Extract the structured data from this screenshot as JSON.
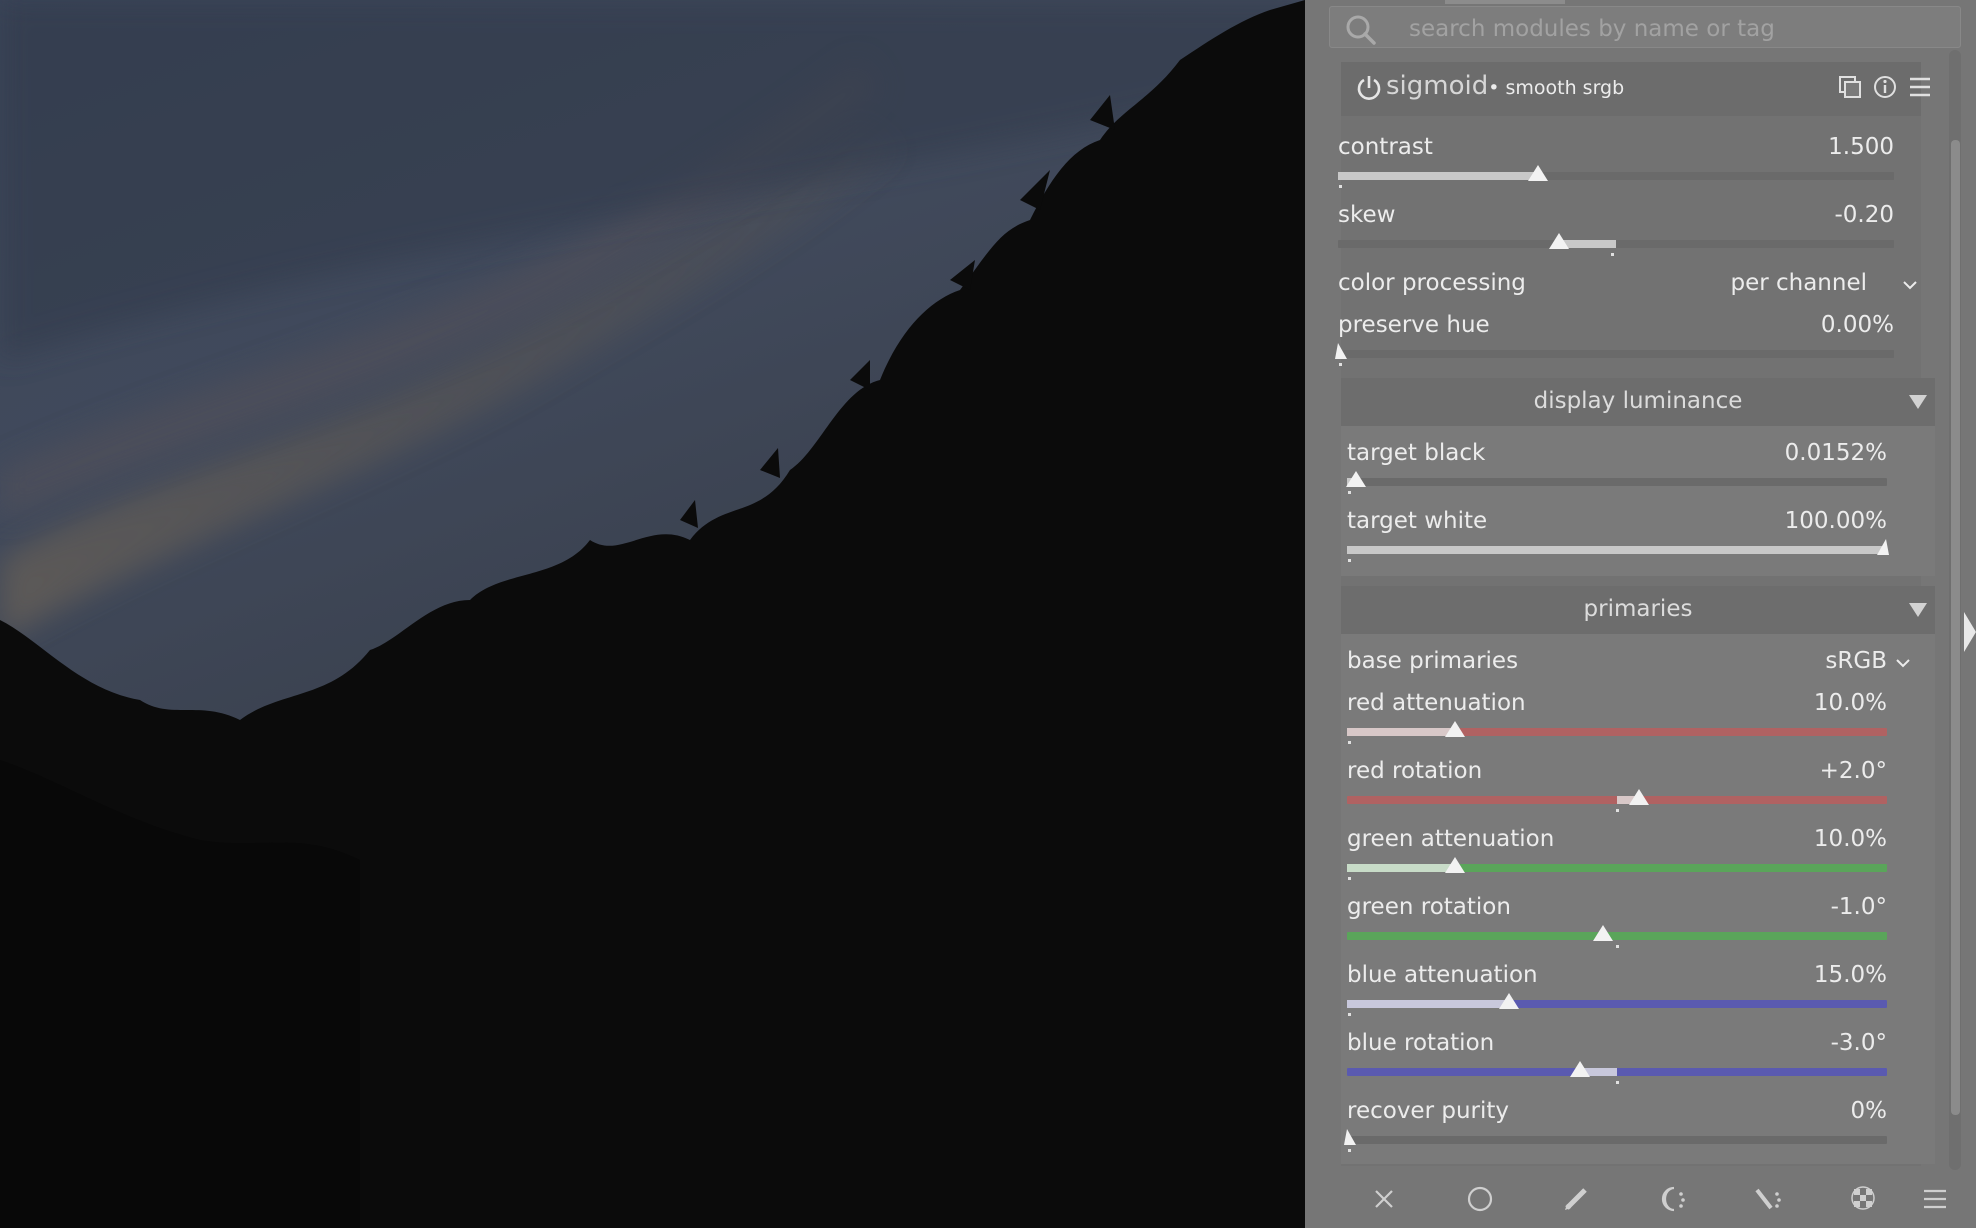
{
  "search": {
    "placeholder": "search modules by name or tag"
  },
  "module": {
    "name": "sigmoid",
    "preset": "• smooth srgb",
    "icons": [
      "power-icon",
      "presets-icon",
      "info-icon",
      "menu-icon"
    ]
  },
  "controls": {
    "contrast": {
      "label": "contrast",
      "value": "1.500",
      "fraction": 0.36
    },
    "skew": {
      "label": "skew",
      "value": "-0.20",
      "fraction": 0.4
    },
    "color_processing": {
      "label": "color processing",
      "value": "per channel"
    },
    "preserve_hue": {
      "label": "preserve hue",
      "value": "0.00%",
      "fraction": 0.0
    }
  },
  "display_luminance": {
    "title": "display luminance",
    "target_black": {
      "label": "target black",
      "value": "0.0152%",
      "fraction": 0.02
    },
    "target_white": {
      "label": "target white",
      "value": "100.00%",
      "fraction": 1.0
    }
  },
  "primaries": {
    "title": "primaries",
    "base_primaries": {
      "label": "base primaries",
      "value": "sRGB"
    },
    "red_attenuation": {
      "label": "red attenuation",
      "value": "10.0%",
      "fraction": 0.2,
      "color": "#b06262"
    },
    "red_rotation": {
      "label": "red rotation",
      "value": "+2.0°",
      "fraction": 0.545,
      "color": "#b06262"
    },
    "green_attenuation": {
      "label": "green attenuation",
      "value": "10.0%",
      "fraction": 0.2,
      "color": "#5aa55a"
    },
    "green_rotation": {
      "label": "green rotation",
      "value": "-1.0°",
      "fraction": 0.478,
      "color": "#5aa55a"
    },
    "blue_attenuation": {
      "label": "blue attenuation",
      "value": "15.0%",
      "fraction": 0.3,
      "color": "#5a5ab0"
    },
    "blue_rotation": {
      "label": "blue rotation",
      "value": "-3.0°",
      "fraction": 0.435,
      "color": "#5a5ab0"
    },
    "recover_purity": {
      "label": "recover purity",
      "value": "0%",
      "fraction": 0.0
    }
  },
  "bottom_toolbar": [
    "close-icon",
    "circle-icon",
    "pencil-icon",
    "moon-gear-icon",
    "brush-gear-icon",
    "checker-icon",
    "menu-icon"
  ]
}
